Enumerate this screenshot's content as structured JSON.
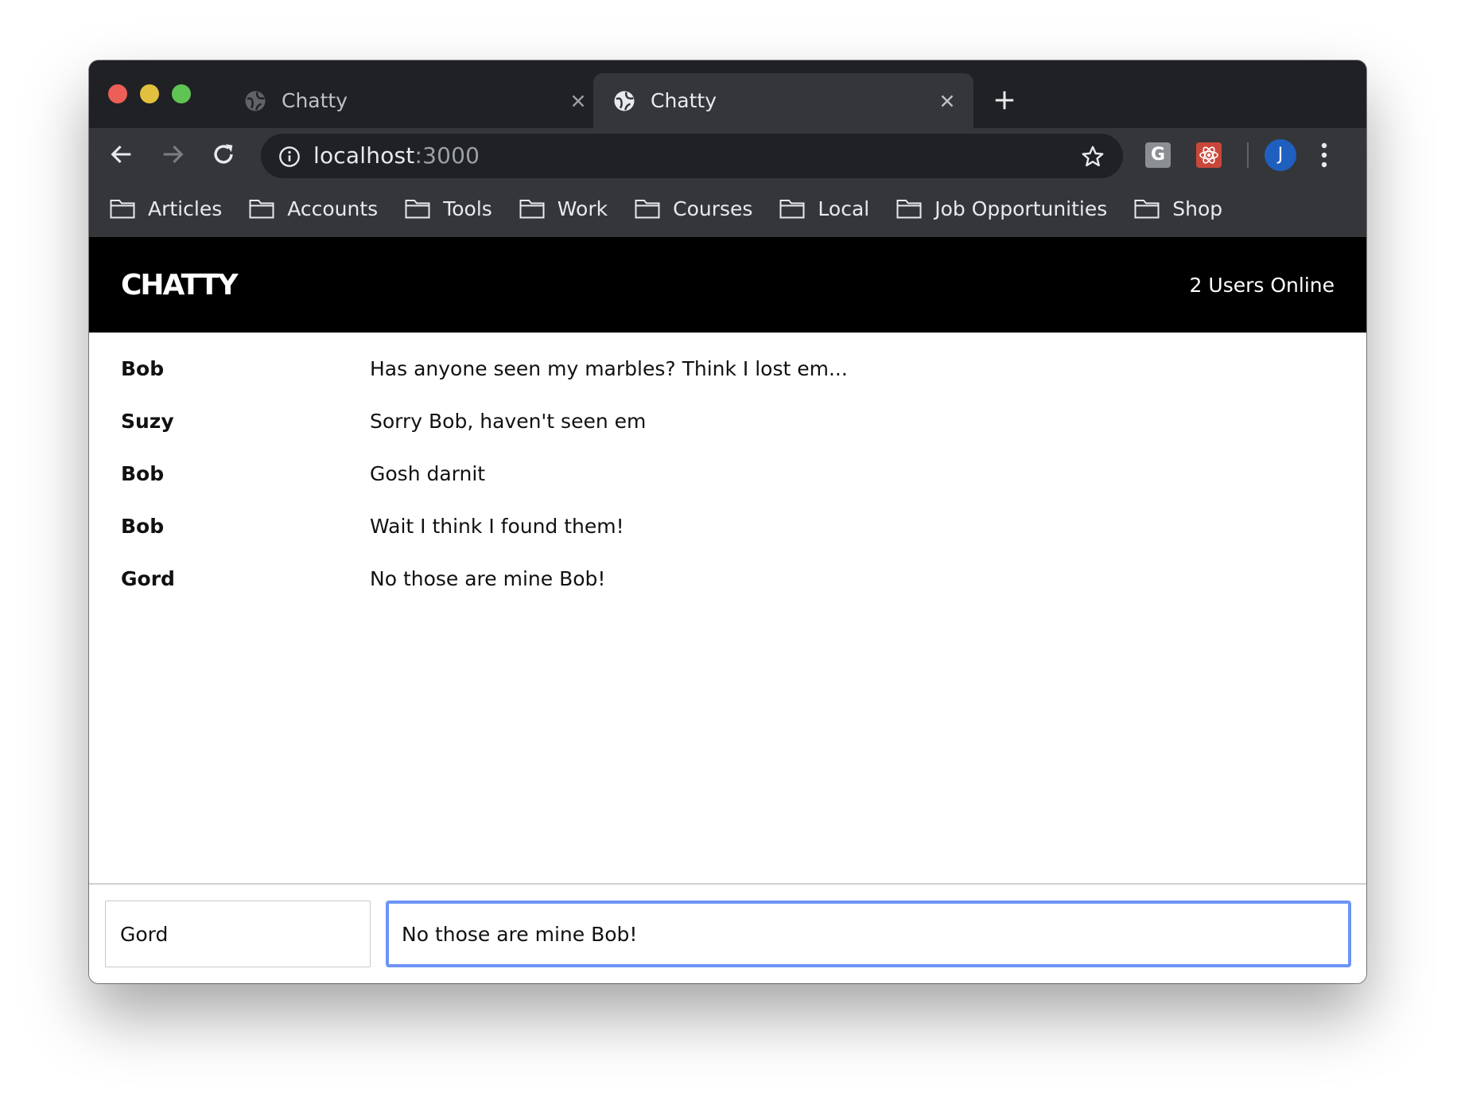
{
  "browser": {
    "tabs": [
      {
        "title": "Chatty",
        "active": false
      },
      {
        "title": "Chatty",
        "active": true
      }
    ],
    "address": {
      "host": "localhost",
      "port": ":3000"
    },
    "extensions": {
      "g_label": "G"
    },
    "profile_initial": "J",
    "bookmarks": [
      "Articles",
      "Accounts",
      "Tools",
      "Work",
      "Courses",
      "Local",
      "Job Opportunities",
      "Shop"
    ]
  },
  "app": {
    "brand": "CHATTY",
    "online_status": "2 Users Online",
    "messages": [
      {
        "user": "Bob",
        "text": "Has anyone seen my marbles? Think I lost em..."
      },
      {
        "user": "Suzy",
        "text": "Sorry Bob, haven't seen em"
      },
      {
        "user": "Bob",
        "text": "Gosh darnit"
      },
      {
        "user": "Bob",
        "text": "Wait I think I found them!"
      },
      {
        "user": "Gord",
        "text": "No those are mine Bob!"
      }
    ],
    "composer": {
      "name_value": "Gord",
      "message_value": "No those are mine Bob!"
    }
  },
  "colors": {
    "chrome_dark": "#202124",
    "chrome_toolbar": "#35363a",
    "header_bg": "#000000",
    "focus_ring": "#6d94f5"
  }
}
